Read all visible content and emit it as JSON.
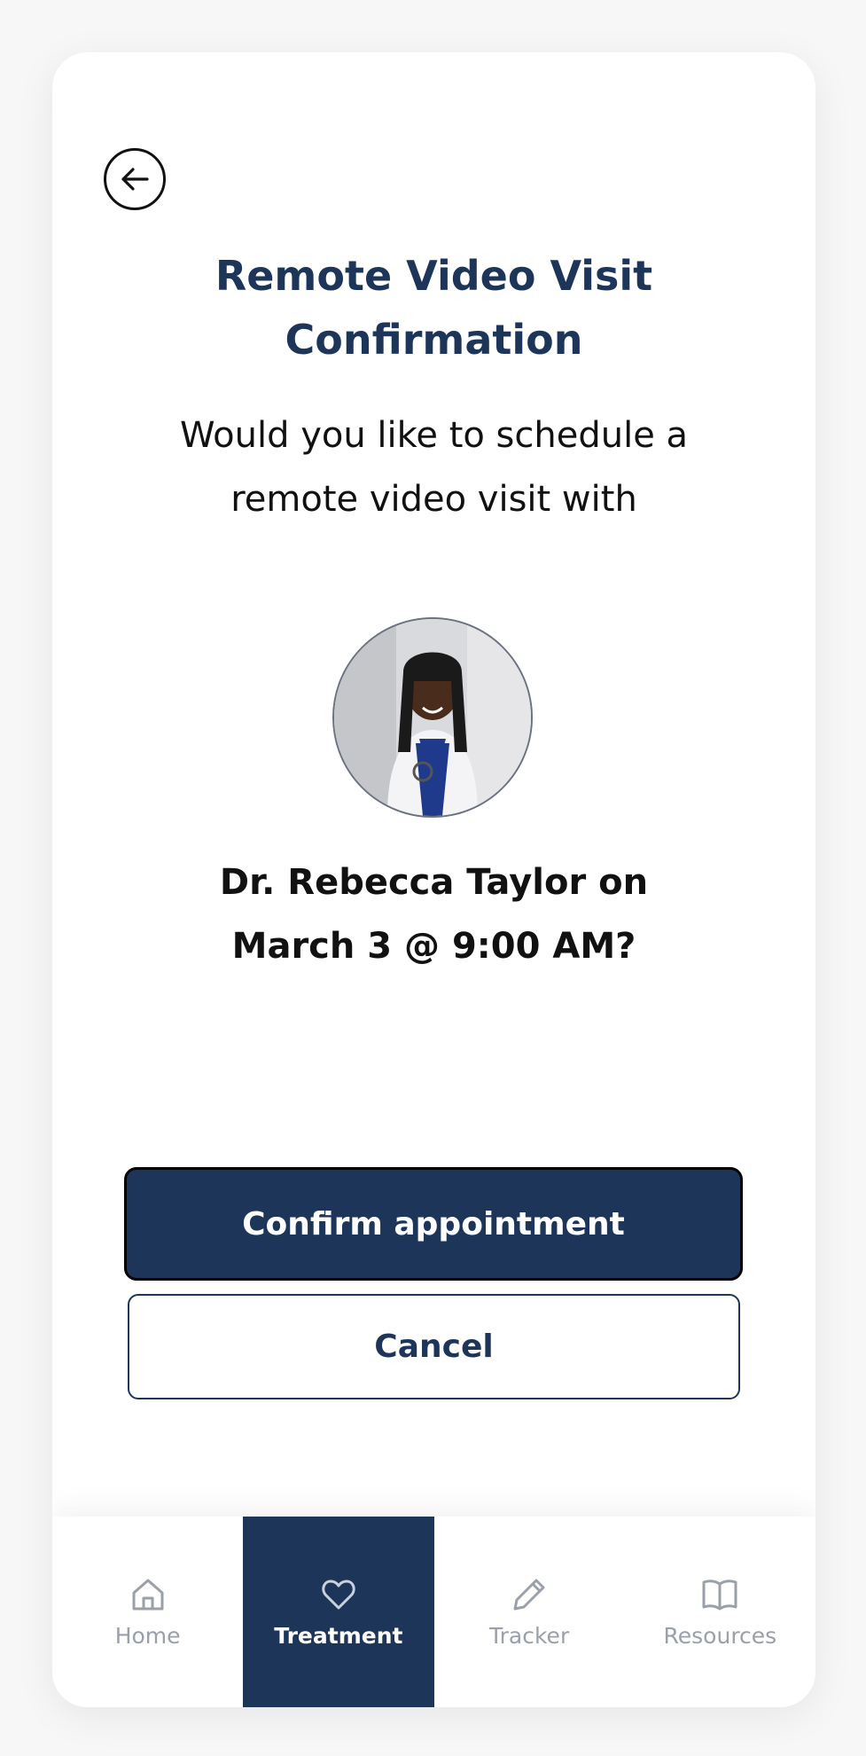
{
  "header": {
    "title_line1": "Remote Video Visit",
    "title_line2": "Confirmation"
  },
  "prompt": {
    "line1": "Would you like to schedule a",
    "line2": "remote video visit with"
  },
  "appointment": {
    "line1": "Dr. Rebecca Taylor on",
    "line2": "March 3 @ 9:00 AM?"
  },
  "actions": {
    "confirm_label": "Confirm appointment",
    "cancel_label": "Cancel"
  },
  "nav": {
    "items": [
      {
        "label": "Home",
        "icon": "home-icon"
      },
      {
        "label": "Treatment",
        "icon": "heart-icon",
        "active": true
      },
      {
        "label": "Tracker",
        "icon": "pencil-icon"
      },
      {
        "label": "Resources",
        "icon": "book-icon"
      }
    ]
  },
  "colors": {
    "primary": "#1e355a",
    "inactive": "#9aa0aa",
    "background": "#ffffff"
  }
}
